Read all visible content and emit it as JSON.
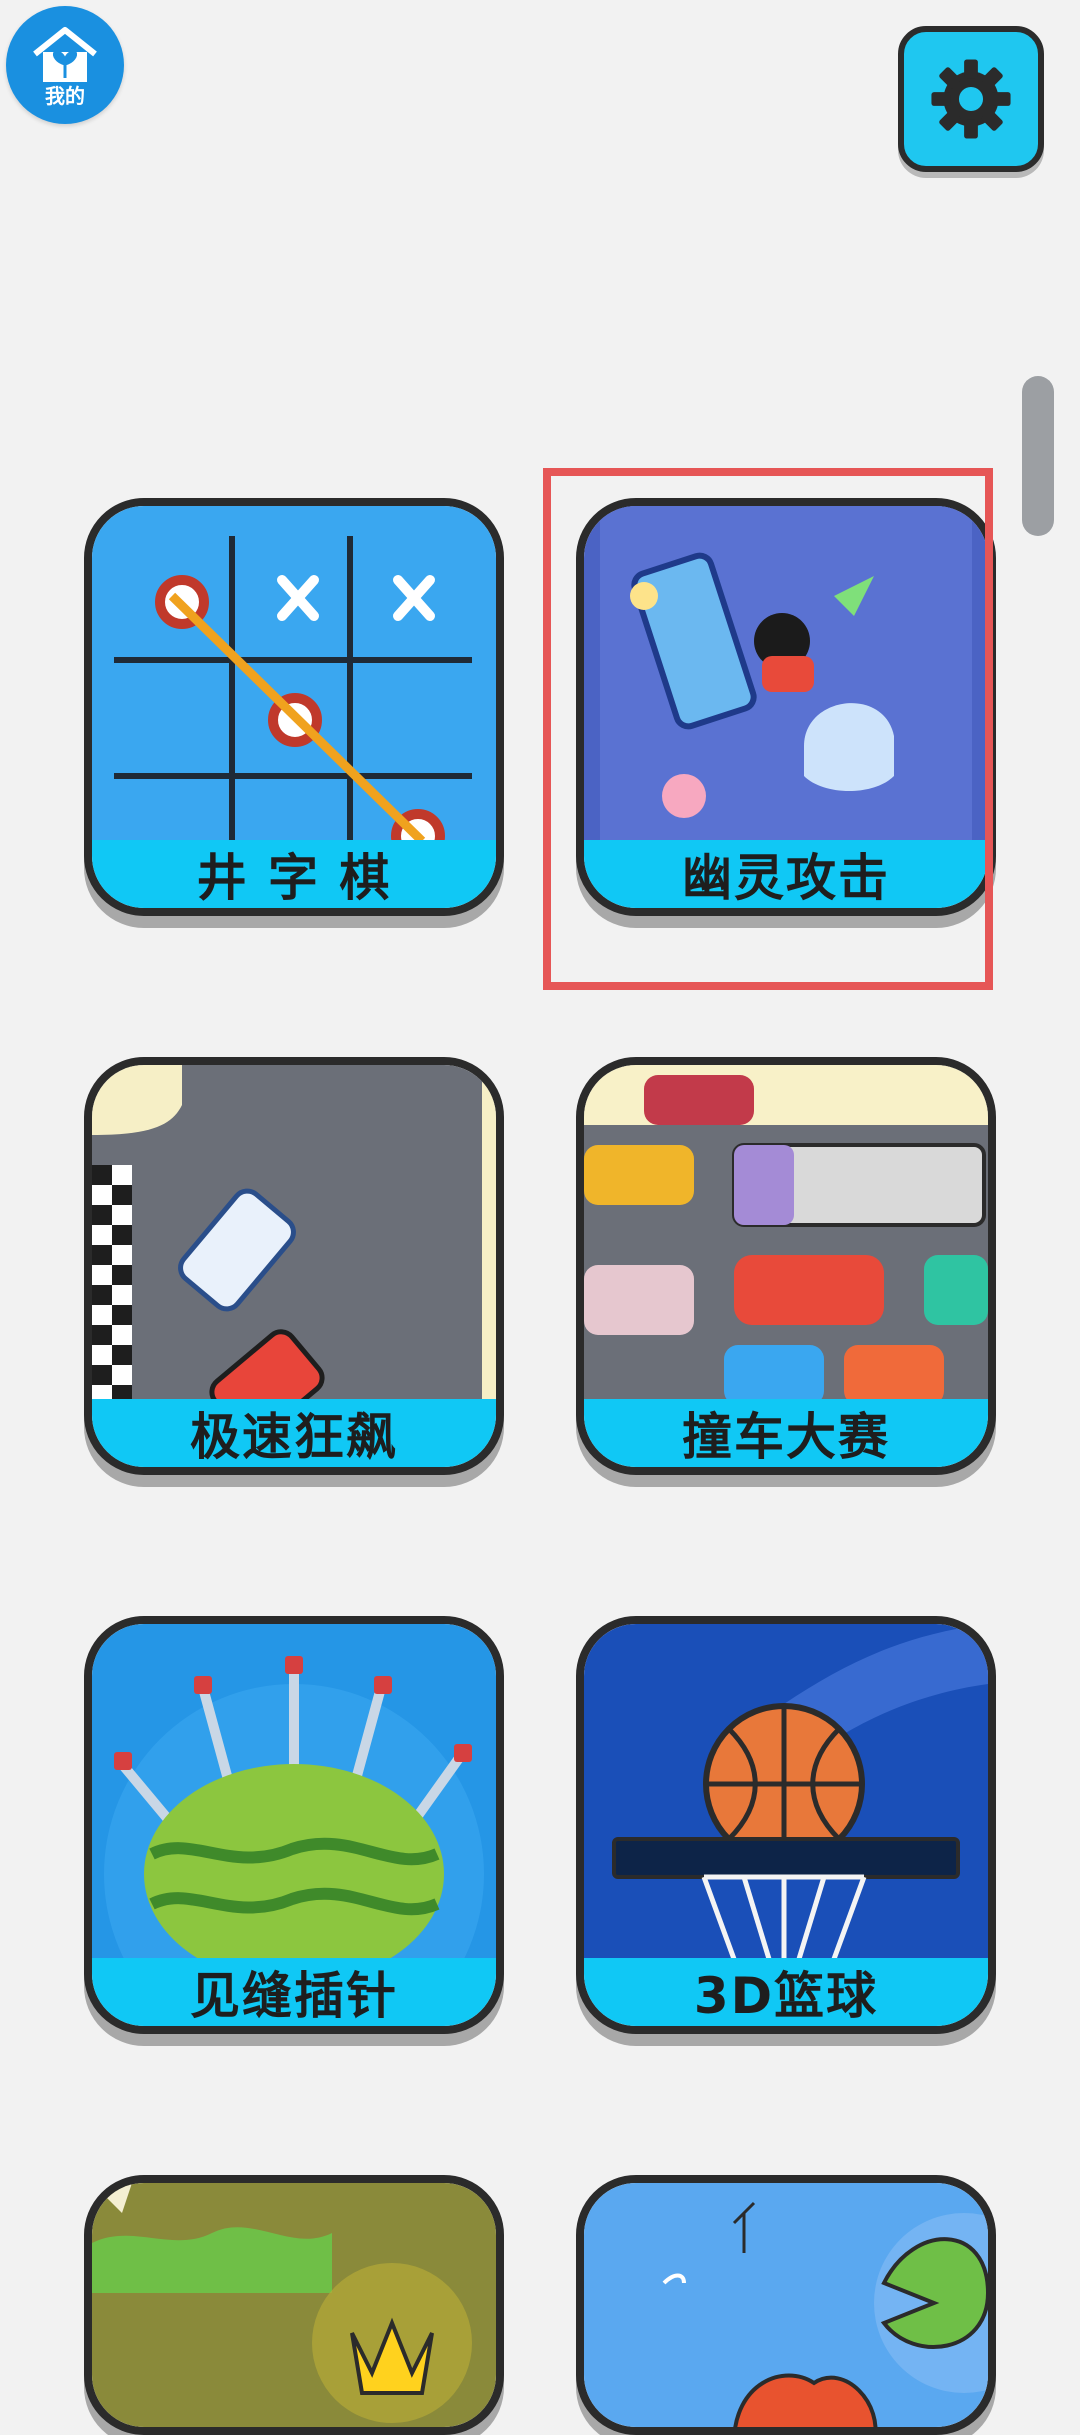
{
  "header": {
    "mine_label": "我的",
    "mine_icon": "house-leaf-icon",
    "settings_icon": "gear-icon"
  },
  "games": [
    {
      "name": "井 字 棋",
      "art": "tic-tac-toe"
    },
    {
      "name": "幽灵攻击",
      "art": "ghost-attack"
    },
    {
      "name": "极速狂飙",
      "art": "racing"
    },
    {
      "name": "撞车大赛",
      "art": "car-crash"
    },
    {
      "name": "见缝插针",
      "art": "knife-watermelon"
    },
    {
      "name": "3D篮球",
      "art": "basketball"
    },
    {
      "name": "",
      "art": "jungle-crown"
    },
    {
      "name": "",
      "art": "frog-pond"
    }
  ],
  "colors": {
    "background": "#f2f2f2",
    "accent": "#10c8f5",
    "highlight": "#e65656"
  }
}
